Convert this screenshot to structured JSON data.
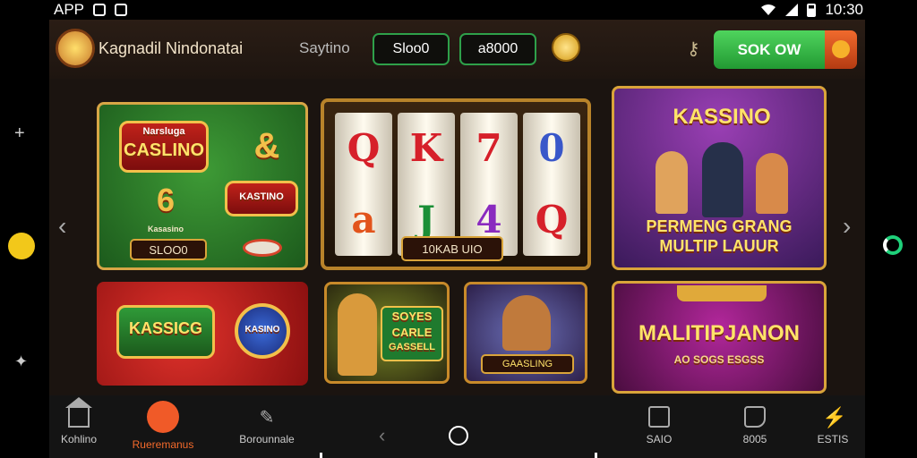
{
  "status_bar": {
    "app_label": "APP",
    "time": "10:30"
  },
  "header": {
    "brand": "Kagnadil Nindonatai",
    "nav_link": "Saytino",
    "balance_1": "Sloo0",
    "balance_2": "a8000",
    "cta_label": "SOK OW"
  },
  "tiles": {
    "casino": {
      "title": "CASLINO",
      "subtitle": "Narsluga",
      "button": "SLOO0",
      "label": "Kasasino",
      "badge": "KASTINO"
    },
    "slot": {
      "reels": [
        [
          "Q",
          "a"
        ],
        [
          "K",
          "J"
        ],
        [
          "7",
          "4"
        ],
        [
          "0",
          "Q"
        ]
      ],
      "button": "10KAB UIO"
    },
    "promo": {
      "title": "KASSINO",
      "line1": "PERMENG GRANG",
      "line2": "MULTIP LAUUR"
    },
    "red": {
      "title": "KASSICG",
      "badge": "KASINO"
    },
    "hero1": {
      "line1": "SOYES",
      "line2": "CARLE",
      "line3": "GASSELL"
    },
    "hero2": {
      "title": "GAASLING"
    },
    "jackpot": {
      "title": "MALITIPJANON",
      "subtitle": "AO SOGS ESGSS"
    }
  },
  "bottom_nav": [
    {
      "label": "Kohlino",
      "icon": "home-icon"
    },
    {
      "label": "Rueremanus",
      "icon": "roulette-icon"
    },
    {
      "label": "Borounnale",
      "icon": "cards-icon"
    },
    {
      "label": "SAIO",
      "icon": "square-icon"
    },
    {
      "label": "8005",
      "icon": "tag-icon"
    },
    {
      "label": "ESTIS",
      "icon": "lightning-icon"
    }
  ],
  "colors": {
    "accent_green": "#2ea04a",
    "accent_orange": "#f46a2b",
    "gold": "#d9a43a"
  }
}
